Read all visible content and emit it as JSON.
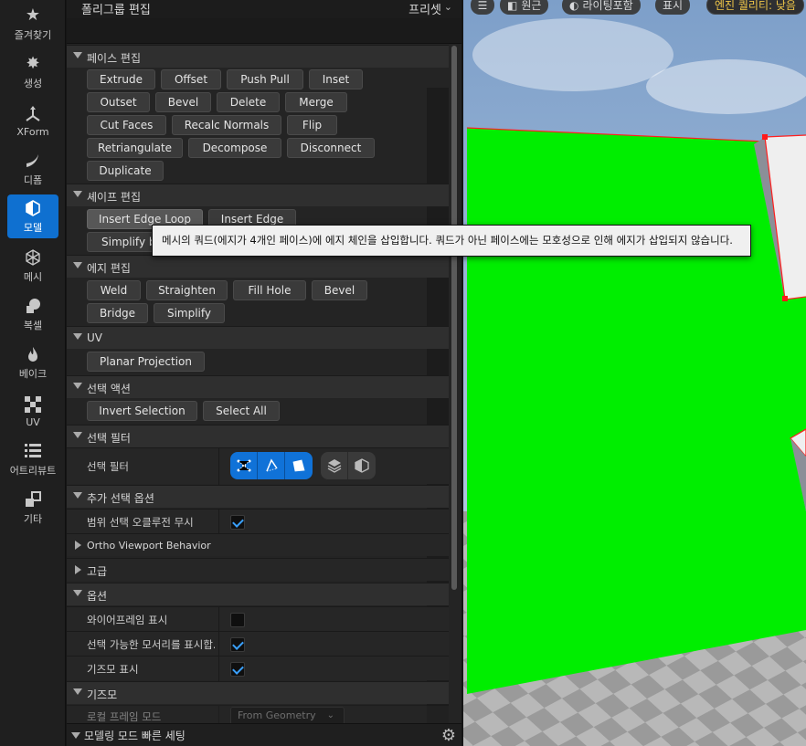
{
  "sidebar": {
    "items": [
      {
        "label": "즐겨찾기",
        "icon": "star-icon"
      },
      {
        "label": "생성",
        "icon": "create-icon"
      },
      {
        "label": "XForm",
        "icon": "xform-icon"
      },
      {
        "label": "디폼",
        "icon": "deform-icon"
      },
      {
        "label": "모델",
        "icon": "model-icon",
        "active": true
      },
      {
        "label": "메시",
        "icon": "mesh-icon"
      },
      {
        "label": "복셀",
        "icon": "voxel-icon"
      },
      {
        "label": "베이크",
        "icon": "bake-icon"
      },
      {
        "label": "UV",
        "icon": "uv-icon"
      },
      {
        "label": "어트리뷰트",
        "icon": "attributes-icon"
      },
      {
        "label": "기타",
        "icon": "misc-icon"
      }
    ]
  },
  "panel": {
    "title": "폴리그룹 편집",
    "preset_label": "프리셋"
  },
  "sections": {
    "face_edit": {
      "title": "페이스 편집",
      "rows": [
        [
          "Extrude",
          "Offset",
          "Push Pull",
          "Inset"
        ],
        [
          "Outset",
          "Bevel",
          "Delete",
          "Merge"
        ],
        [
          "Cut Faces",
          "Recalc Normals",
          "Flip"
        ],
        [
          "Retriangulate",
          "Decompose",
          "Disconnect"
        ],
        [
          "Duplicate"
        ]
      ]
    },
    "shape_edit": {
      "title": "셰이프 편집",
      "rows": [
        [
          "Insert Edge Loop",
          "Insert Edge"
        ],
        [
          "Simplify b"
        ]
      ]
    },
    "edge_edit": {
      "title": "에지 편집",
      "rows": [
        [
          "Weld",
          "Straighten",
          "Fill Hole",
          "Bevel"
        ],
        [
          "Bridge",
          "Simplify"
        ]
      ]
    },
    "uv": {
      "title": "UV",
      "rows": [
        [
          "Planar Projection"
        ]
      ]
    },
    "selection_actions": {
      "title": "선택 액션",
      "rows": [
        [
          "Invert Selection",
          "Select All"
        ]
      ]
    },
    "selection_filter": {
      "title": "선택 필터",
      "label": "선택 필터"
    },
    "extra_selection": {
      "title": "추가 선택 옵션",
      "props": [
        {
          "label": "범위 선택 오클루전 무시",
          "checked": true
        }
      ]
    },
    "ortho": {
      "title": "Ortho Viewport Behavior"
    },
    "advanced": {
      "title": "고급"
    },
    "options": {
      "title": "옵션",
      "props": [
        {
          "label": "와이어프레임 표시",
          "checked": false
        },
        {
          "label": "선택 가능한 모서리를 표시합...",
          "checked": true
        },
        {
          "label": "기즈모 표시",
          "checked": true
        }
      ]
    },
    "gizmo": {
      "title": "기즈모",
      "frame_mode_label": "로컬 프레임 모드",
      "frame_mode_value": "From Geometry"
    }
  },
  "footer": {
    "title": "모델링 모드 빠른 세팅"
  },
  "viewport": {
    "perspective": "원근",
    "lighting": "라이팅포함",
    "show": "표시",
    "quality_warning": "엔진 퀄리티: 낮음"
  },
  "tooltip": {
    "text": "메시의 쿼드(에지가 4개인 페이스)에 에지 체인을 삽입합니다. 쿼드가 아닌 페이스에는 모호성으로 인해 에지가 삽입되지 않습니다."
  }
}
